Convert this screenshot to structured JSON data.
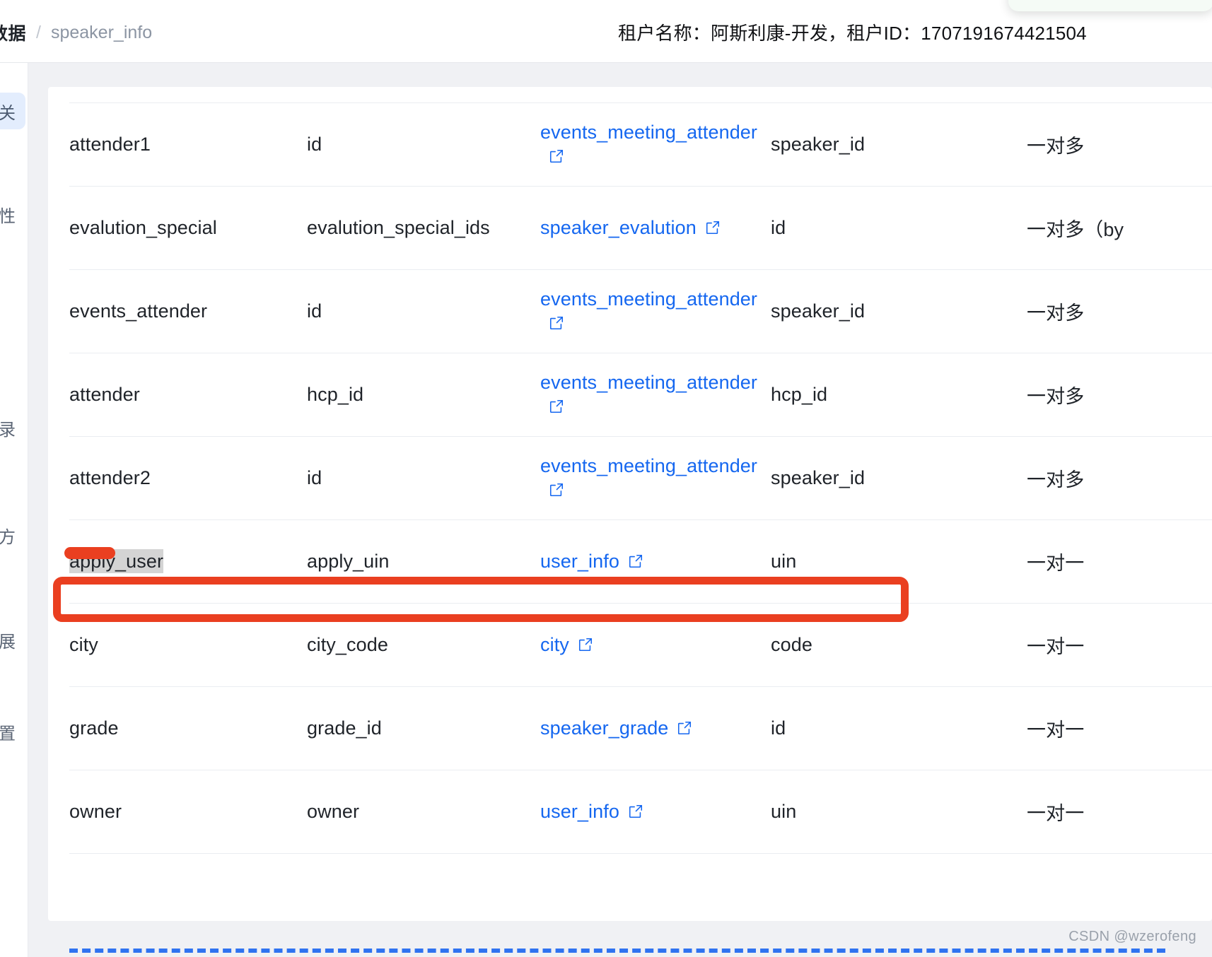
{
  "header": {
    "breadcrumb": {
      "root_label": "数据",
      "separator": "/",
      "leaf_label": "speaker_info"
    },
    "tenant_info": "租户名称：阿斯利康-开发，租户ID：1707191674421504"
  },
  "sidebar": {
    "items": [
      {
        "label": "关",
        "active": true
      },
      {
        "label": "性",
        "active": false
      },
      {
        "label": "录",
        "active": false
      },
      {
        "label": "方",
        "active": false
      },
      {
        "label": "展",
        "active": false
      },
      {
        "label": "置",
        "active": false
      }
    ]
  },
  "table": {
    "icon_name": "external-link-icon",
    "rows": [
      {
        "alias": "attender1",
        "field": "id",
        "target_table": "events_meeting_attender",
        "target_field": "speaker_id",
        "relation": "一对多",
        "wrap": true
      },
      {
        "alias": "evalution_special",
        "field": "evalution_special_ids",
        "target_table": "speaker_evalution",
        "target_field": "id",
        "relation": "一对多（by",
        "wrap": false
      },
      {
        "alias": "events_attender",
        "field": "id",
        "target_table": "events_meeting_attender",
        "target_field": "speaker_id",
        "relation": "一对多",
        "wrap": true
      },
      {
        "alias": "attender",
        "field": "hcp_id",
        "target_table": "events_meeting_attender",
        "target_field": "hcp_id",
        "relation": "一对多",
        "wrap": true
      },
      {
        "alias": "attender2",
        "field": "id",
        "target_table": "events_meeting_attender",
        "target_field": "speaker_id",
        "relation": "一对多",
        "wrap": true
      },
      {
        "alias": "apply_user",
        "field": "apply_uin",
        "target_table": "user_info",
        "target_field": "uin",
        "relation": "一对一",
        "wrap": false,
        "selected": true
      },
      {
        "alias": "city",
        "field": "city_code",
        "target_table": "city",
        "target_field": "code",
        "relation": "一对一",
        "wrap": false
      },
      {
        "alias": "grade",
        "field": "grade_id",
        "target_table": "speaker_grade",
        "target_field": "id",
        "relation": "一对一",
        "wrap": false
      },
      {
        "alias": "owner",
        "field": "owner",
        "target_table": "user_info",
        "target_field": "uin",
        "relation": "一对一",
        "wrap": false
      }
    ]
  },
  "annotation": {
    "color": "#ea3f20",
    "highlight_row_alias": "apply_user"
  },
  "watermark": {
    "text": "CSDN @wzerofeng"
  }
}
